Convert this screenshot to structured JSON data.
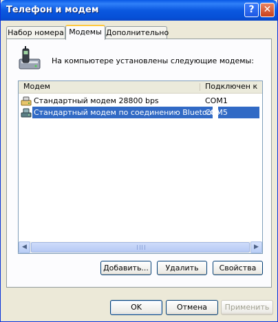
{
  "window": {
    "title": "Телефон и модем"
  },
  "titlebar": {
    "help_icon": "question-mark",
    "close_icon": "x-mark"
  },
  "tabs": [
    {
      "label": "Набор номера",
      "active": false
    },
    {
      "label": "Модемы",
      "active": true
    },
    {
      "label": "Дополнительно",
      "active": false
    }
  ],
  "panel": {
    "icon": "phone-modem-icon",
    "description": "На компьютере установлены следующие модемы:"
  },
  "modem_list": {
    "columns": [
      "Модем",
      "Подключен к"
    ],
    "rows": [
      {
        "modem": "Стандартный модем 28800 bps",
        "port": "COM1",
        "icon": "modem-icon",
        "selected": false
      },
      {
        "modem": "Стандартный модем по соединению Bluetooth",
        "port": "COM5",
        "icon": "bluetooth-modem-icon",
        "selected": true
      }
    ]
  },
  "actions": {
    "add": "Добавить...",
    "remove": "Удалить",
    "properties": "Свойства"
  },
  "footer": {
    "ok": "OK",
    "cancel": "Отмена",
    "apply": "Применить"
  },
  "colors": {
    "selection": "#316ac5",
    "titlebar": "#0a5ae6",
    "window_bg": "#ece9d8"
  }
}
